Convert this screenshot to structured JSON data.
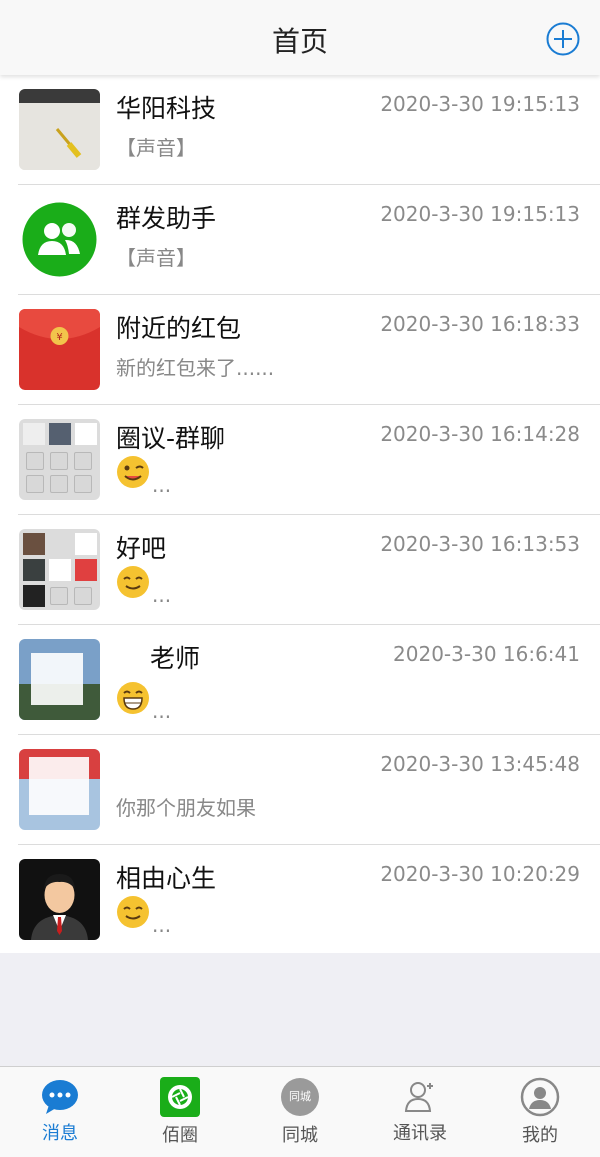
{
  "header": {
    "title": "首页"
  },
  "conversations": [
    {
      "name": "华阳科技",
      "time": "2020-3-30 19:15:13",
      "preview": "【声音】"
    },
    {
      "name": "群发助手",
      "time": "2020-3-30 19:15:13",
      "preview": "【声音】"
    },
    {
      "name": "附近的红包",
      "time": "2020-3-30 16:18:33",
      "preview": "新的红包来了......"
    },
    {
      "name": "圈议-群聊",
      "time": "2020-3-30 16:14:28",
      "preview": "..."
    },
    {
      "name": "好吧",
      "time": "2020-3-30 16:13:53",
      "preview": "..."
    },
    {
      "name": "老师",
      "time": "2020-3-30 16:6:41",
      "preview": "..."
    },
    {
      "name": "",
      "time": "2020-3-30 13:45:48",
      "preview": "你那个朋友如果"
    },
    {
      "name": "相由心生",
      "time": "2020-3-30 10:20:29",
      "preview": "..."
    }
  ],
  "tabs": [
    {
      "label": "消息"
    },
    {
      "label": "佰圈"
    },
    {
      "label": "同城",
      "badge": "同城"
    },
    {
      "label": "通讯录"
    },
    {
      "label": "我的"
    }
  ],
  "colors": {
    "accent": "#1a7cd3",
    "green": "#1aad19",
    "red": "#d9322c"
  }
}
